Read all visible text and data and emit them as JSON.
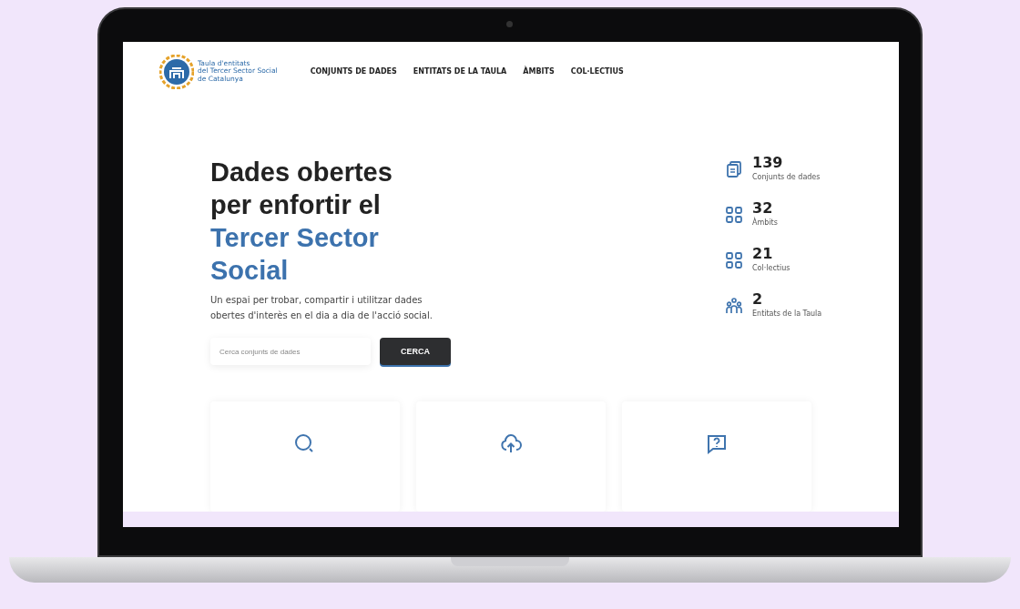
{
  "logo": {
    "lines": [
      "Taula d'entitats",
      "del Tercer Sector Social",
      "de Catalunya"
    ]
  },
  "nav": [
    {
      "label": "CONJUNTS DE DADES"
    },
    {
      "label": "ENTITATS DE LA TAULA"
    },
    {
      "label": "ÀMBITS"
    },
    {
      "label": "COL·LECTIUS"
    }
  ],
  "hero": {
    "title_dark": [
      "Dades obertes",
      "per enfortir el"
    ],
    "title_accent": [
      "Tercer Sector",
      "Social"
    ],
    "subtitle": "Un espai per trobar, compartir i utilitzar dades obertes d'interès en el dia a dia de l'acció social.",
    "search": {
      "placeholder": "Cerca conjunts de dades"
    },
    "button": "CERCA"
  },
  "stats": [
    {
      "kind": "documents",
      "value": "139",
      "label": "Conjunts de dades"
    },
    {
      "kind": "grid",
      "value": "32",
      "label": "Àmbits"
    },
    {
      "kind": "grid",
      "value": "21",
      "label": "Col·lectius"
    },
    {
      "kind": "people",
      "value": "2",
      "label": "Entitats de la Taula"
    }
  ],
  "cards": [
    {
      "kind": "search"
    },
    {
      "kind": "upload"
    },
    {
      "kind": "question"
    }
  ]
}
